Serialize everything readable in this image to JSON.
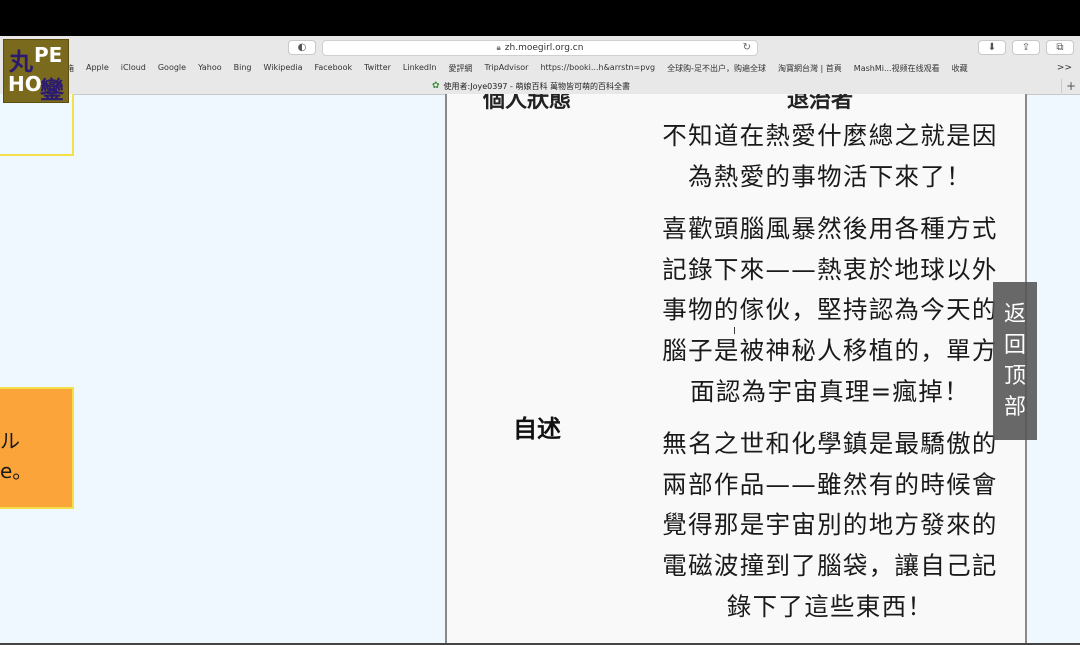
{
  "browser": {
    "url": "zh.moegirl.org.cn",
    "bookmarks": [
      "Apple",
      "iCloud",
      "Google",
      "Yahoo",
      "Bing",
      "Wikipedia",
      "Facebook",
      "Twitter",
      "LinkedIn",
      "愛評網",
      "TripAdvisor",
      "https://booki...h&arrstn=pvg",
      "全球购-足不出户，购遍全球",
      "淘寶網台灣 | 首頁",
      "MashMi...视频在线观看",
      "收藏"
    ],
    "bookmarks_prefix": "箱",
    "more_label": ">>",
    "tab_title": "使用者:Joye0397 - 萌娘百科 萬物皆可萌的百科全書",
    "new_tab_label": "+"
  },
  "logo": {
    "text_a": "PE",
    "text_b": "HO",
    "text_c": "丸",
    "text_d": "鑾"
  },
  "left_panel": {
    "text_line1": "ル",
    "text_line2": "e。"
  },
  "profile": {
    "cut_left": "個人狀態",
    "cut_right": "退治者",
    "self_label": "自述",
    "para1": [
      "不知道在熱愛什麼總之就是因",
      "為熱愛的事物活下來了！"
    ],
    "para2": [
      "喜歡頭腦風暴然後用各種方式",
      "記錄下來——熱衷於地球以外",
      "事物的傢伙，堅持認為今天的",
      "腦子是被神秘人移植的，單方",
      "面認為宇宙真理=瘋掉！"
    ],
    "para3": [
      "無名之世和化學鎮是最驕傲的",
      "兩部作品——雖然有的時候會",
      "覺得那是宇宙別的地方發來的",
      "電磁波撞到了腦袋，讓自己記",
      "錄下了這些東西！"
    ]
  },
  "back_to_top": [
    "返",
    "回",
    "顶",
    "部"
  ],
  "icons": [
    "shield-icon",
    "lock-icon",
    "reload-icon",
    "download-icon",
    "share-icon",
    "tabs-icon",
    "text-cursor-icon"
  ]
}
